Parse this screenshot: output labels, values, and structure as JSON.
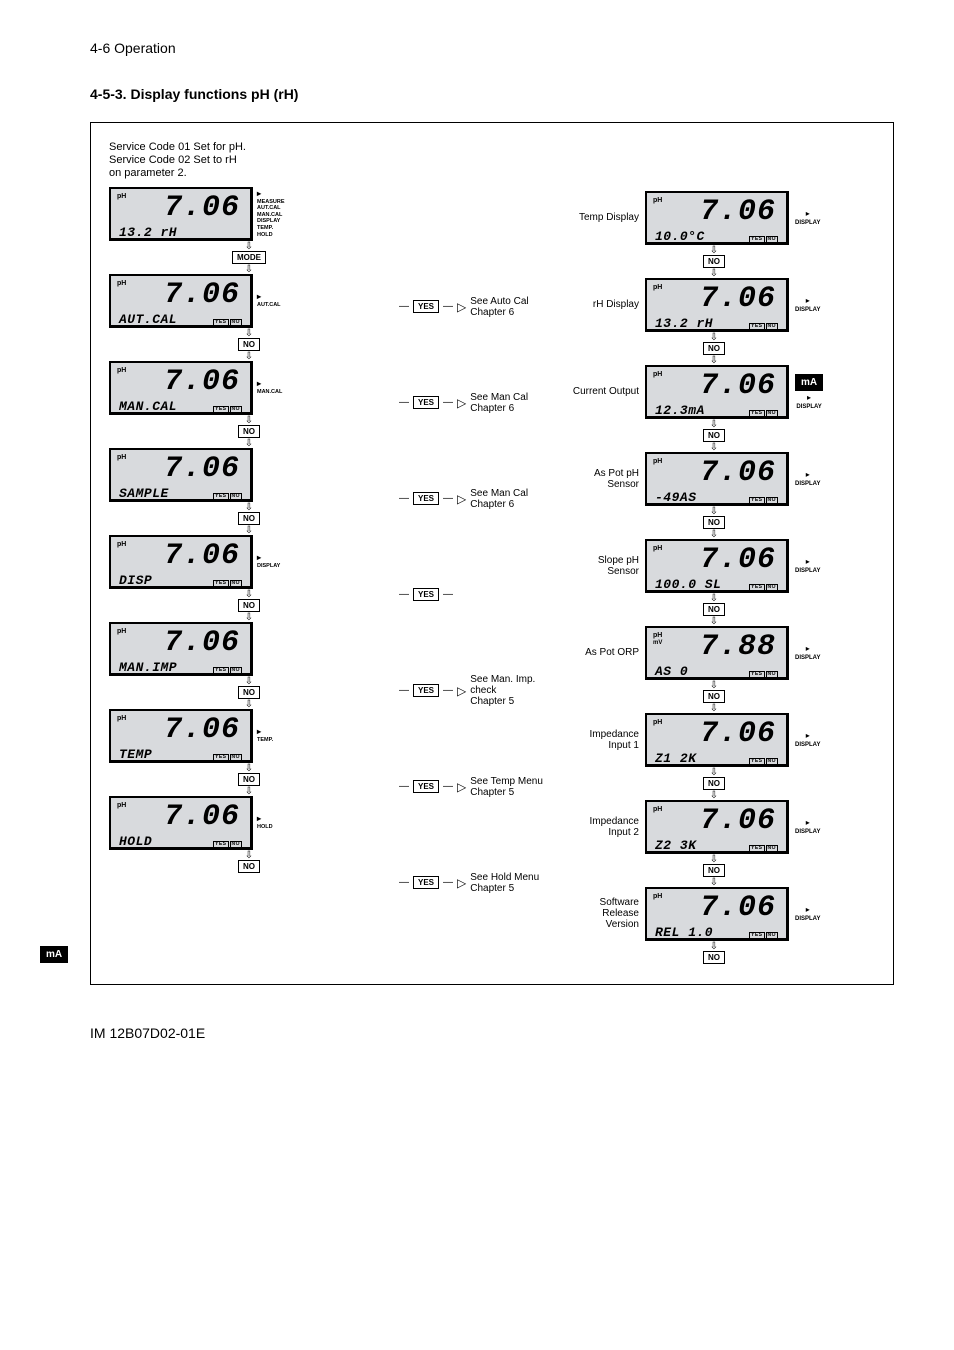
{
  "header": "4-6 Operation",
  "section_title": "4-5-3. Display functions pH (rH)",
  "intro_line1": "Service Code 01 Set  for pH.",
  "intro_line2": "Service Code 02 Set to rH",
  "intro_line3": "on parameter 2.",
  "keys": {
    "mode": "MODE",
    "yes": "YES",
    "no": "NO"
  },
  "yn": {
    "yes": "YES",
    "no": "NO"
  },
  "side_modes": {
    "all": "MEASURE\nAUT.CAL\nMAN.CAL\nDISPLAY\nTEMP.\nHOLD",
    "autcal": "AUT.CAL",
    "mancal": "MAN.CAL",
    "display": "DISPLAY",
    "temp": "TEMP.",
    "hold": "HOLD"
  },
  "lcd": {
    "ph": "pH",
    "mv": "mV",
    "main_706": "7.06",
    "main_788": "7.88"
  },
  "left_items": [
    {
      "sub_left": "13.2 rH",
      "sub_right": "",
      "side": "all",
      "below_key": "MODE"
    },
    {
      "sub_left": "AUT.CAL",
      "sub_right": "yn",
      "side": "autcal",
      "below_key": "NO",
      "mid": "See Auto Cal Chapter 6",
      "mid_yes": true
    },
    {
      "sub_left": "MAN.CAL",
      "sub_right": "yn",
      "side": "mancal",
      "below_key": "NO",
      "mid": "See Man Cal Chapter 6",
      "mid_yes": true
    },
    {
      "sub_left": "SAMPLE",
      "sub_right": "yn",
      "side": "",
      "below_key": "NO",
      "mid": "See Man Cal Chapter 6",
      "mid_yes": true
    },
    {
      "sub_left": "DISP",
      "sub_right": "yn",
      "side": "display",
      "below_key": "NO",
      "mid": "",
      "mid_yes": true
    },
    {
      "sub_left": "MAN.IMP",
      "sub_right": "yn",
      "side": "",
      "below_key": "NO",
      "mid": "See Man. Imp. check Chapter 5",
      "mid_yes": true
    },
    {
      "sub_left": "TEMP",
      "sub_right": "yn",
      "side": "temp",
      "below_key": "NO",
      "mid": "See Temp Menu Chapter 5",
      "mid_yes": true
    },
    {
      "sub_left": "HOLD",
      "sub_right": "yn",
      "side": "hold",
      "below_key": "NO",
      "mid": "See Hold Menu Chapter 5",
      "mid_yes": true
    }
  ],
  "right_items": [
    {
      "label": "Temp Display",
      "sub_left": "10.0°C",
      "sub_right": "yn",
      "main": "7.06",
      "unit": "pH"
    },
    {
      "label": "rH Display",
      "sub_left": "13.2 rH",
      "sub_right": "yn",
      "main": "7.06",
      "unit": "pH"
    },
    {
      "label": "Current Output",
      "sub_left": "12.3mA",
      "sub_right": "yn",
      "main": "7.06",
      "unit": "pH",
      "ma_badge": true
    },
    {
      "label": "As Pot pH Sensor",
      "sub_left": "-49AS",
      "sub_right": "yn",
      "main": "7.06",
      "unit": "pH"
    },
    {
      "label": "Slope pH Sensor",
      "sub_left": "100.0 SL",
      "sub_right": "yn",
      "main": "7.06",
      "unit": "pH"
    },
    {
      "label": "As Pot ORP",
      "sub_left": "AS         0",
      "sub_right": "yn",
      "main": "7.88",
      "unit": "mV"
    },
    {
      "label": "Impedance Input 1",
      "sub_left": "Z1      2K",
      "sub_right": "yn",
      "main": "7.06",
      "unit": "pH"
    },
    {
      "label": "Impedance Input 2",
      "sub_left": "Z2      3K",
      "sub_right": "yn",
      "main": "7.06",
      "unit": "pH"
    },
    {
      "label": "Software Release Version",
      "sub_left": "REL    1.0",
      "sub_right": "yn",
      "main": "7.06",
      "unit": "pH"
    }
  ],
  "display_tag": "DISPLAY",
  "ma_text": "mA",
  "footer": "IM 12B07D02-01E"
}
